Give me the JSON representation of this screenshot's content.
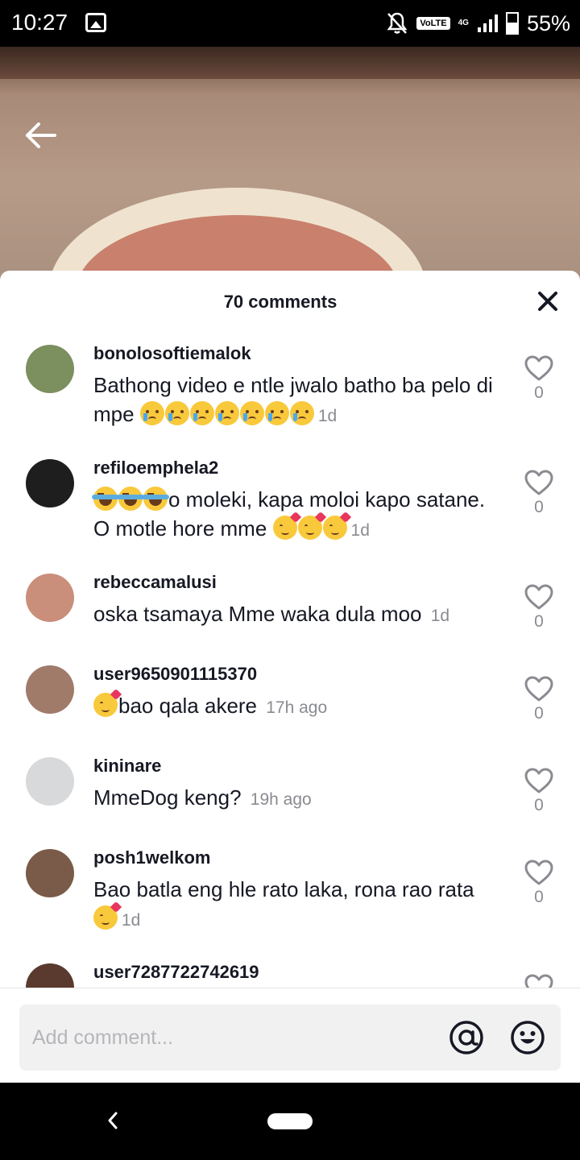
{
  "status": {
    "time": "10:27",
    "volte": "VoLTE",
    "network": "4G",
    "battery": "55%"
  },
  "sheet": {
    "title": "70 comments"
  },
  "comments": [
    {
      "username": "bonolosoftiemalok",
      "text": "Bathong video e ntle jwalo batho ba pelo di mpe",
      "emojis_after": [
        "cry",
        "cry",
        "cry",
        "cry",
        "cry",
        "cry",
        "cry"
      ],
      "time": "1d",
      "likes": "0",
      "avatar_color": "#7c8f5e"
    },
    {
      "username": "refiloemphela2",
      "emojis_before": [
        "laugh",
        "laugh",
        "laugh"
      ],
      "text": "o moleki, kapa moloi kapo satane. O motle hore mme",
      "emojis_after": [
        "love",
        "love",
        "love"
      ],
      "time": "1d",
      "likes": "0",
      "avatar_color": "#1e1e1e"
    },
    {
      "username": "rebeccamalusi",
      "text": "oska tsamaya Mme waka dula moo",
      "time": "1d",
      "likes": "0",
      "avatar_color": "#c98f7a"
    },
    {
      "username": "user9650901115370",
      "emojis_before": [
        "love"
      ],
      "text": "bao qala akere",
      "time": "17h ago",
      "likes": "0",
      "avatar_color": "#a07b6a"
    },
    {
      "username": "kininare",
      "text": "MmeDog keng?",
      "time": "19h ago",
      "likes": "0",
      "avatar_color": "#d8d9db"
    },
    {
      "username": "posh1welkom",
      "text": "Bao batla eng hle rato laka, rona rao rata",
      "emojis_after": [
        "love"
      ],
      "time": "1d",
      "likes": "0",
      "avatar_color": "#7a5a48"
    },
    {
      "username": "user7287722742619",
      "text": "",
      "time": "",
      "likes": "",
      "avatar_color": "#5a3a2e"
    }
  ],
  "input": {
    "placeholder": "Add comment..."
  },
  "icons": {
    "back": "arrow-left-icon",
    "close": "close-icon",
    "heart": "heart-outline-icon",
    "mention": "at-sign-icon",
    "emoji": "emoji-face-icon"
  }
}
